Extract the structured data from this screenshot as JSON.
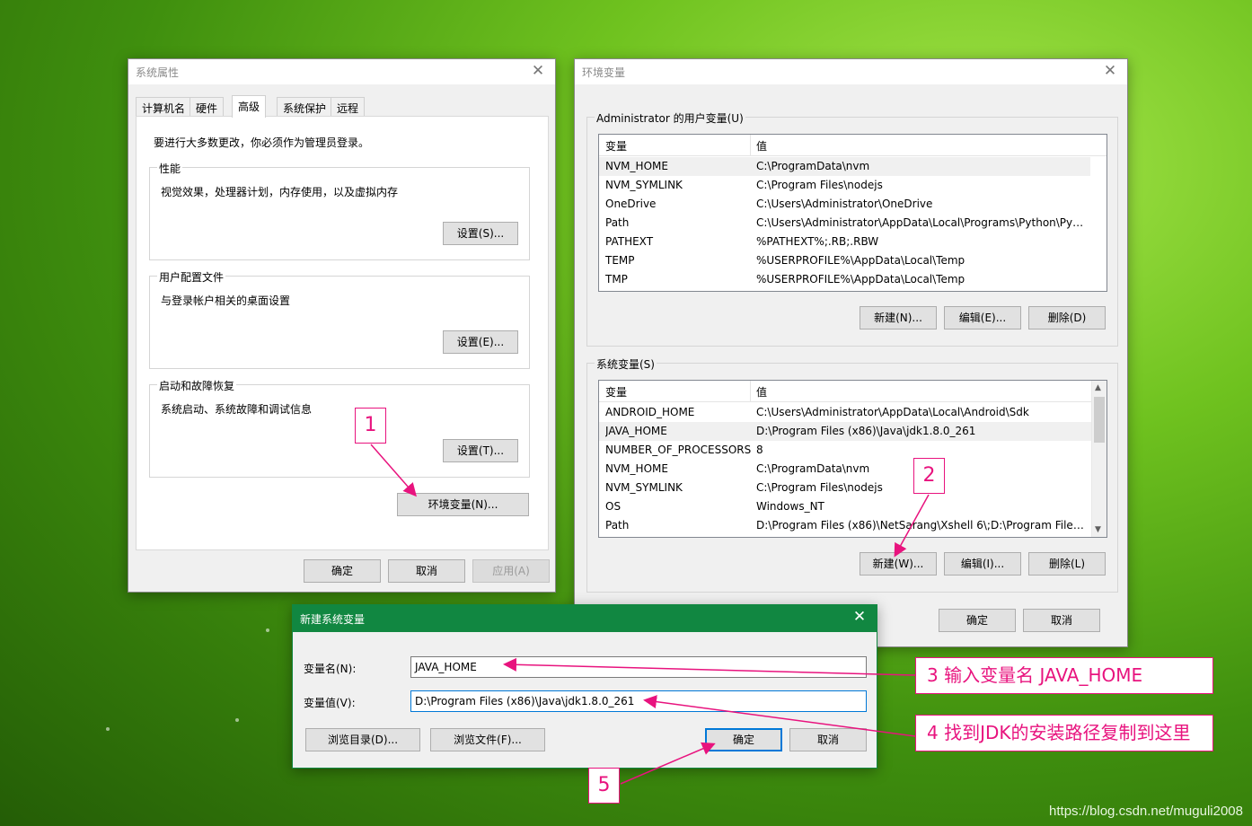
{
  "sysprops": {
    "title": "系统属性",
    "close": "✕",
    "tabs": [
      "计算机名",
      "硬件",
      "高级",
      "系统保护",
      "远程"
    ],
    "notice": "要进行大多数更改，你必须作为管理员登录。",
    "perf_label": "性能",
    "perf_desc": "视觉效果，处理器计划，内存使用，以及虚拟内存",
    "perf_btn": "设置(S)...",
    "profile_label": "用户配置文件",
    "profile_desc": "与登录帐户相关的桌面设置",
    "profile_btn": "设置(E)...",
    "startup_label": "启动和故障恢复",
    "startup_desc": "系统启动、系统故障和调试信息",
    "startup_btn": "设置(T)...",
    "env_btn": "环境变量(N)...",
    "ok": "确定",
    "cancel": "取消",
    "apply": "应用(A)"
  },
  "envvars": {
    "title": "环境变量",
    "close": "✕",
    "user_group": "Administrator 的用户变量(U)",
    "sys_group": "系统变量(S)",
    "col_var": "变量",
    "col_val": "值",
    "user_rows": [
      [
        "NVM_HOME",
        "C:\\ProgramData\\nvm"
      ],
      [
        "NVM_SYMLINK",
        "C:\\Program Files\\nodejs"
      ],
      [
        "OneDrive",
        "C:\\Users\\Administrator\\OneDrive"
      ],
      [
        "Path",
        "C:\\Users\\Administrator\\AppData\\Local\\Programs\\Python\\Pyt..."
      ],
      [
        "PATHEXT",
        "%PATHEXT%;.RB;.RBW"
      ],
      [
        "TEMP",
        "%USERPROFILE%\\AppData\\Local\\Temp"
      ],
      [
        "TMP",
        "%USERPROFILE%\\AppData\\Local\\Temp"
      ]
    ],
    "sys_rows": [
      [
        "ANDROID_HOME",
        "C:\\Users\\Administrator\\AppData\\Local\\Android\\Sdk"
      ],
      [
        "JAVA_HOME",
        "D:\\Program Files (x86)\\Java\\jdk1.8.0_261"
      ],
      [
        "NUMBER_OF_PROCESSORS",
        "8"
      ],
      [
        "NVM_HOME",
        "C:\\ProgramData\\nvm"
      ],
      [
        "NVM_SYMLINK",
        "C:\\Program Files\\nodejs"
      ],
      [
        "OS",
        "Windows_NT"
      ],
      [
        "Path",
        "D:\\Program Files (x86)\\NetSarang\\Xshell 6\\;D:\\Program Files ..."
      ]
    ],
    "user_new": "新建(N)...",
    "user_edit": "编辑(E)...",
    "user_delete": "删除(D)",
    "sys_new": "新建(W)...",
    "sys_edit": "编辑(I)...",
    "sys_delete": "删除(L)",
    "ok": "确定",
    "cancel": "取消"
  },
  "newvar": {
    "title": "新建系统变量",
    "close": "✕",
    "name_label": "变量名(N):",
    "name_value": "JAVA_HOME",
    "value_label": "变量值(V):",
    "value_value": "D:\\Program Files (x86)\\Java\\jdk1.8.0_261",
    "browse_dir": "浏览目录(D)...",
    "browse_file": "浏览文件(F)...",
    "ok": "确定",
    "cancel": "取消"
  },
  "annotations": {
    "a1": "1",
    "a2": "2",
    "a3": "3 输入变量名 JAVA_HOME",
    "a4": "4 找到JDK的安装路径复制到这里",
    "a5": "5",
    "color": "#e8137e"
  },
  "watermark": "https://blog.csdn.net/muguli2008"
}
